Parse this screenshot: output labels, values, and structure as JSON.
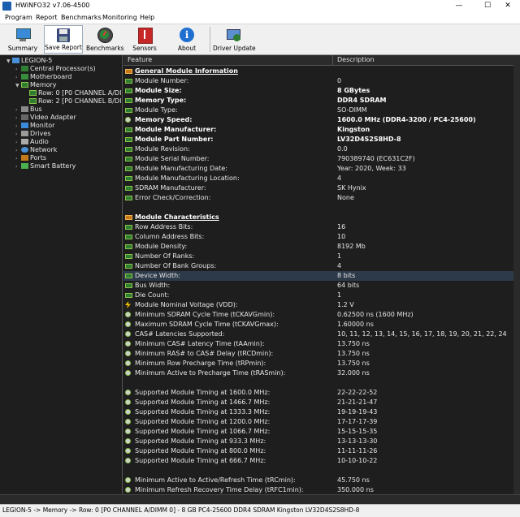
{
  "window": {
    "title": "HWiNFO32 v7.06-4500",
    "minimize": "—",
    "maximize": "☐",
    "close": "✕"
  },
  "menu": [
    "Program",
    "Report",
    "Benchmarks",
    "Monitoring",
    "Help"
  ],
  "toolbar": {
    "summary": "Summary",
    "save_report": "Save Report",
    "benchmarks": "Benchmarks",
    "sensors": "Sensors",
    "about": "About",
    "driver_update": "Driver Update"
  },
  "tree": [
    {
      "label": "LEGION-5",
      "exp": "▼",
      "icon": "computer-icon"
    },
    {
      "label": "Central Processor(s)",
      "exp": "›",
      "icon": "cpu-icon"
    },
    {
      "label": "Motherboard",
      "exp": "›",
      "icon": "motherboard-icon"
    },
    {
      "label": "Memory",
      "exp": "▼",
      "icon": "memory-icon"
    },
    {
      "label": "Row: 0 [P0 CHANNEL A/DI",
      "exp": "",
      "icon": "memory-module-icon"
    },
    {
      "label": "Row: 2 [P0 CHANNEL B/DI",
      "exp": "",
      "icon": "memory-module-icon"
    },
    {
      "label": "Bus",
      "exp": "›",
      "icon": "bus-icon"
    },
    {
      "label": "Video Adapter",
      "exp": "›",
      "icon": "video-adapter-icon"
    },
    {
      "label": "Monitor",
      "exp": "›",
      "icon": "monitor-icon"
    },
    {
      "label": "Drives",
      "exp": "›",
      "icon": "drive-icon"
    },
    {
      "label": "Audio",
      "exp": "›",
      "icon": "audio-icon"
    },
    {
      "label": "Network",
      "exp": "›",
      "icon": "network-icon"
    },
    {
      "label": "Ports",
      "exp": "›",
      "icon": "port-icon"
    },
    {
      "label": "Smart Battery",
      "exp": "›",
      "icon": "battery-icon"
    }
  ],
  "columns": {
    "feature": "Feature",
    "description": "Description"
  },
  "rows": [
    {
      "f": "General Module Information",
      "d": "",
      "t": "section"
    },
    {
      "f": "Module Number:",
      "d": "0",
      "t": "ram"
    },
    {
      "f": "Module Size:",
      "d": "8 GBytes",
      "t": "ram",
      "b": true
    },
    {
      "f": "Memory Type:",
      "d": "DDR4 SDRAM",
      "t": "ram",
      "b": true
    },
    {
      "f": "Module Type:",
      "d": "SO-DIMM",
      "t": "ram"
    },
    {
      "f": "Memory Speed:",
      "d": "1600.0 MHz (DDR4-3200 / PC4-25600)",
      "t": "clock",
      "b": true
    },
    {
      "f": "Module Manufacturer:",
      "d": "Kingston",
      "t": "ram",
      "b": true
    },
    {
      "f": "Module Part Number:",
      "d": "LV32D4S2S8HD-8",
      "t": "ram",
      "b": true
    },
    {
      "f": "Module Revision:",
      "d": "0.0",
      "t": "ram"
    },
    {
      "f": "Module Serial Number:",
      "d": "790389740 (EC631C2F)",
      "t": "ram"
    },
    {
      "f": "Module Manufacturing Date:",
      "d": "Year: 2020, Week: 33",
      "t": "ram"
    },
    {
      "f": "Module Manufacturing Location:",
      "d": "4",
      "t": "ram"
    },
    {
      "f": "SDRAM Manufacturer:",
      "d": "SK Hynix",
      "t": "ram"
    },
    {
      "f": "Error Check/Correction:",
      "d": "None",
      "t": "ram"
    },
    {
      "f": "",
      "d": "",
      "t": "blank"
    },
    {
      "f": "Module Characteristics",
      "d": "",
      "t": "section"
    },
    {
      "f": "Row Address Bits:",
      "d": "16",
      "t": "ram"
    },
    {
      "f": "Column Address Bits:",
      "d": "10",
      "t": "ram"
    },
    {
      "f": "Module Density:",
      "d": "8192 Mb",
      "t": "ram"
    },
    {
      "f": "Number Of Ranks:",
      "d": "1",
      "t": "ram"
    },
    {
      "f": "Number Of Bank Groups:",
      "d": "4",
      "t": "ram"
    },
    {
      "f": "Device Width:",
      "d": "8 bits",
      "t": "ram",
      "hl": true
    },
    {
      "f": "Bus Width:",
      "d": "64 bits",
      "t": "ram"
    },
    {
      "f": "Die Count:",
      "d": "1",
      "t": "ram"
    },
    {
      "f": "Module Nominal Voltage (VDD):",
      "d": "1.2 V",
      "t": "bolt"
    },
    {
      "f": "Minimum SDRAM Cycle Time (tCKAVGmin):",
      "d": "0.62500 ns (1600 MHz)",
      "t": "clock"
    },
    {
      "f": "Maximum SDRAM Cycle Time (tCKAVGmax):",
      "d": "1.60000 ns",
      "t": "clock"
    },
    {
      "f": "CAS# Latencies Supported:",
      "d": "10, 11, 12, 13, 14, 15, 16, 17, 18, 19, 20, 21, 22, 24",
      "t": "clock"
    },
    {
      "f": "Minimum CAS# Latency Time (tAAmin):",
      "d": "13.750 ns",
      "t": "clock"
    },
    {
      "f": "Minimum RAS# to CAS# Delay (tRCDmin):",
      "d": "13.750 ns",
      "t": "clock"
    },
    {
      "f": "Minimum Row Precharge Time (tRPmin):",
      "d": "13.750 ns",
      "t": "clock"
    },
    {
      "f": "Minimum Active to Precharge Time (tRASmin):",
      "d": "32.000 ns",
      "t": "clock"
    },
    {
      "f": "",
      "d": "",
      "t": "blank"
    },
    {
      "f": "Supported Module Timing at 1600.0 MHz:",
      "d": "22-22-22-52",
      "t": "clock"
    },
    {
      "f": "Supported Module Timing at 1466.7 MHz:",
      "d": "21-21-21-47",
      "t": "clock"
    },
    {
      "f": "Supported Module Timing at 1333.3 MHz:",
      "d": "19-19-19-43",
      "t": "clock"
    },
    {
      "f": "Supported Module Timing at 1200.0 MHz:",
      "d": "17-17-17-39",
      "t": "clock"
    },
    {
      "f": "Supported Module Timing at 1066.7 MHz:",
      "d": "15-15-15-35",
      "t": "clock"
    },
    {
      "f": "Supported Module Timing at 933.3 MHz:",
      "d": "13-13-13-30",
      "t": "clock"
    },
    {
      "f": "Supported Module Timing at 800.0 MHz:",
      "d": "11-11-11-26",
      "t": "clock"
    },
    {
      "f": "Supported Module Timing at 666.7 MHz:",
      "d": "10-10-10-22",
      "t": "clock"
    },
    {
      "f": "",
      "d": "",
      "t": "blank"
    },
    {
      "f": "Minimum Active to Active/Refresh Time (tRCmin):",
      "d": "45.750 ns",
      "t": "clock"
    },
    {
      "f": "Minimum Refresh Recovery Time Delay (tRFC1min):",
      "d": "350.000 ns",
      "t": "clock"
    }
  ],
  "status_bar": "LEGION-5 -> Memory -> Row: 0 [P0 CHANNEL A/DIMM 0] - 8 GB PC4-25600 DDR4 SDRAM Kingston LV32D4S2S8HD-8"
}
